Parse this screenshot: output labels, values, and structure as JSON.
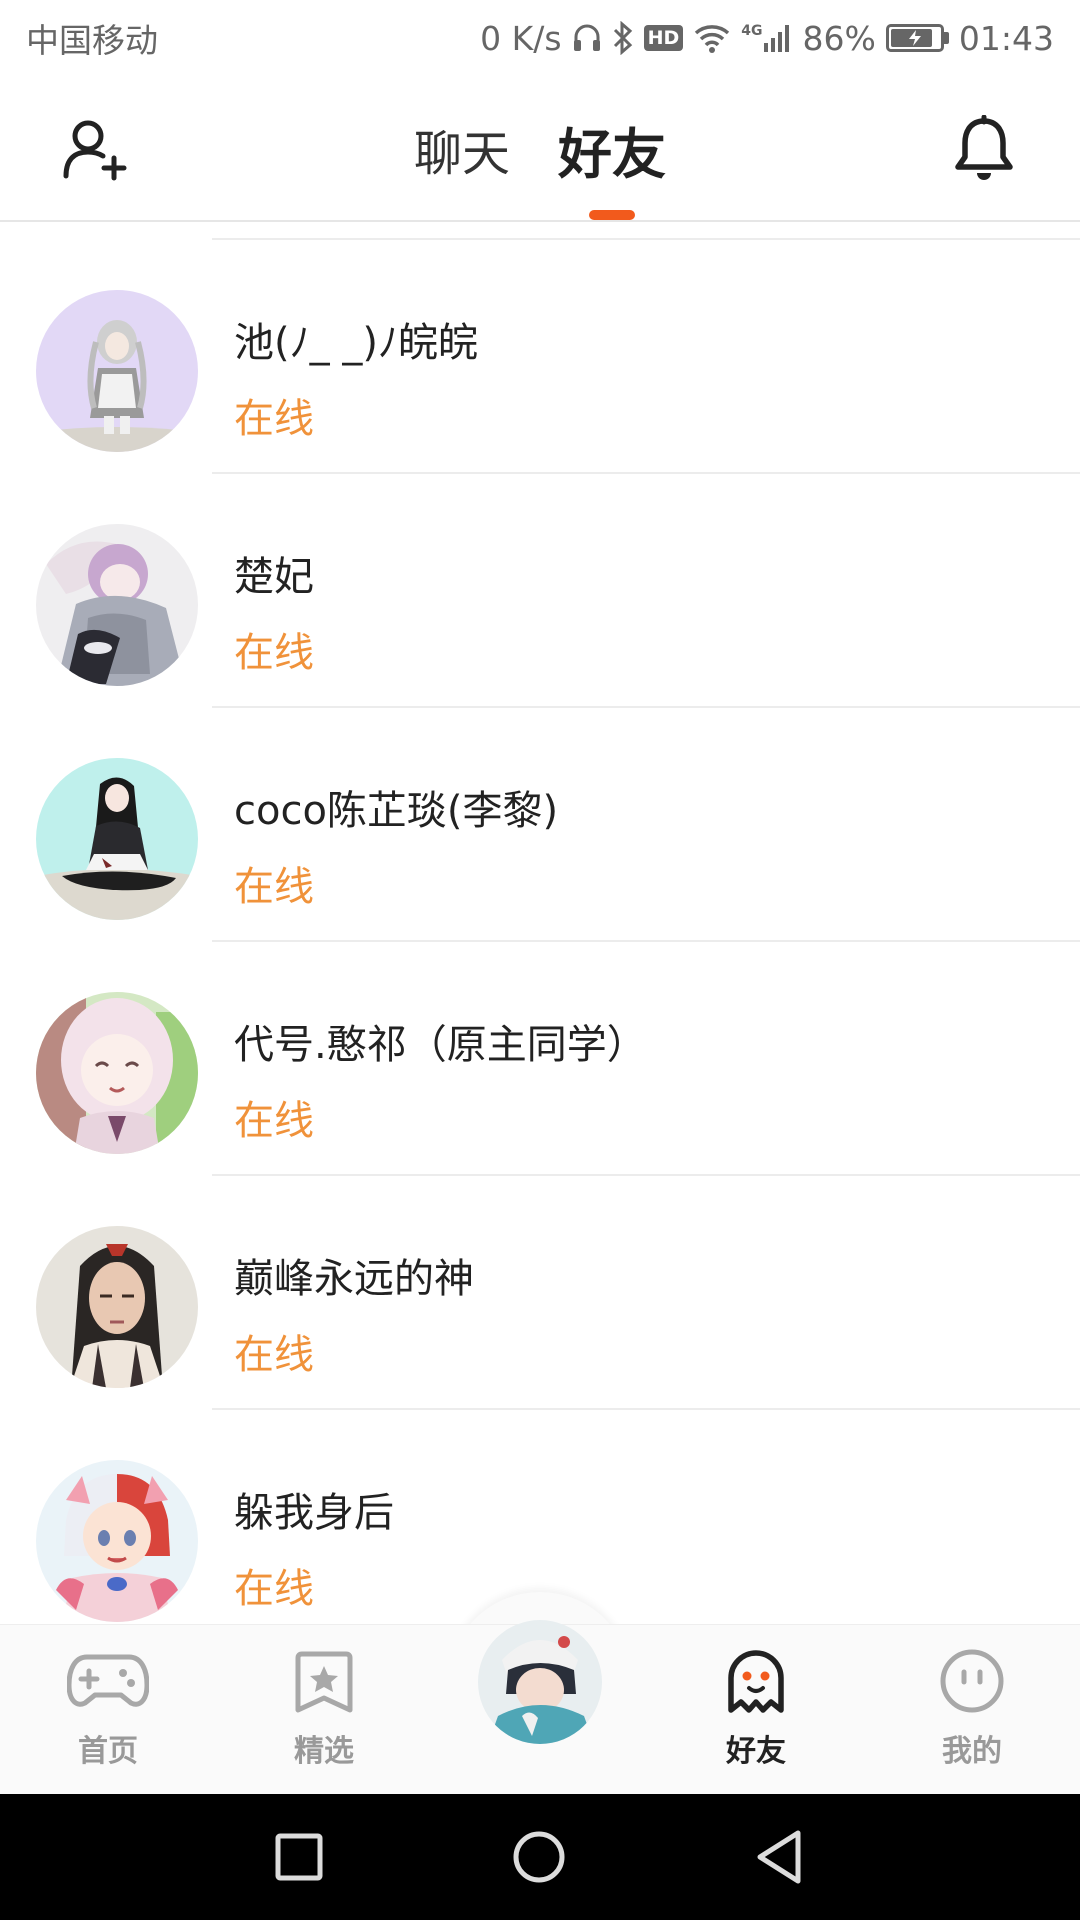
{
  "status_bar": {
    "carrier": "中国移动",
    "net_speed": "0 K/s",
    "hd": "HD",
    "network_type": "4G",
    "battery_percent": "86%",
    "battery_level": 0.86,
    "time": "01:43",
    "icons": [
      "headphones-icon",
      "bluetooth-icon",
      "wifi-icon",
      "signal-icon",
      "battery-icon"
    ]
  },
  "header": {
    "tabs": [
      {
        "label": "聊天",
        "active": false
      },
      {
        "label": "好友",
        "active": true
      }
    ],
    "left_icon": "add-friend-icon",
    "right_icon": "bell-icon",
    "accent_color": "#f25a1c"
  },
  "friends": [
    {
      "name": "池(ﾉ_ _)ﾉ皖皖",
      "status": "在线",
      "avatar": "avatar-anime-girl-white-dress"
    },
    {
      "name": "楚妃",
      "status": "在线",
      "avatar": "avatar-anime-pink-hair-hoodie"
    },
    {
      "name": "coco陈芷琰(李黎)",
      "status": "在线",
      "avatar": "avatar-anime-black-hair-sitting"
    },
    {
      "name": "代号.憨祁（原主同学）",
      "status": "在线",
      "avatar": "avatar-anime-pink-hair-smiling"
    },
    {
      "name": "巅峰永远的神",
      "status": "在线",
      "avatar": "avatar-anime-dark-hair-man"
    },
    {
      "name": "躲我身后",
      "status": "在线",
      "avatar": "avatar-anime-white-red-hair"
    }
  ],
  "status_color": "#f0923a",
  "bottom_nav": {
    "items": [
      {
        "label": "首页",
        "icon": "gamepad-icon",
        "active": false
      },
      {
        "label": "精选",
        "icon": "star-bookmark-icon",
        "active": false
      },
      {
        "label": "",
        "icon": "user-avatar-center",
        "active": false
      },
      {
        "label": "好友",
        "icon": "ghost-icon",
        "active": true
      },
      {
        "label": "我的",
        "icon": "face-icon",
        "active": false
      }
    ]
  },
  "system_nav": {
    "icons": [
      "recent-apps-icon",
      "home-circle-icon",
      "back-triangle-icon"
    ]
  }
}
